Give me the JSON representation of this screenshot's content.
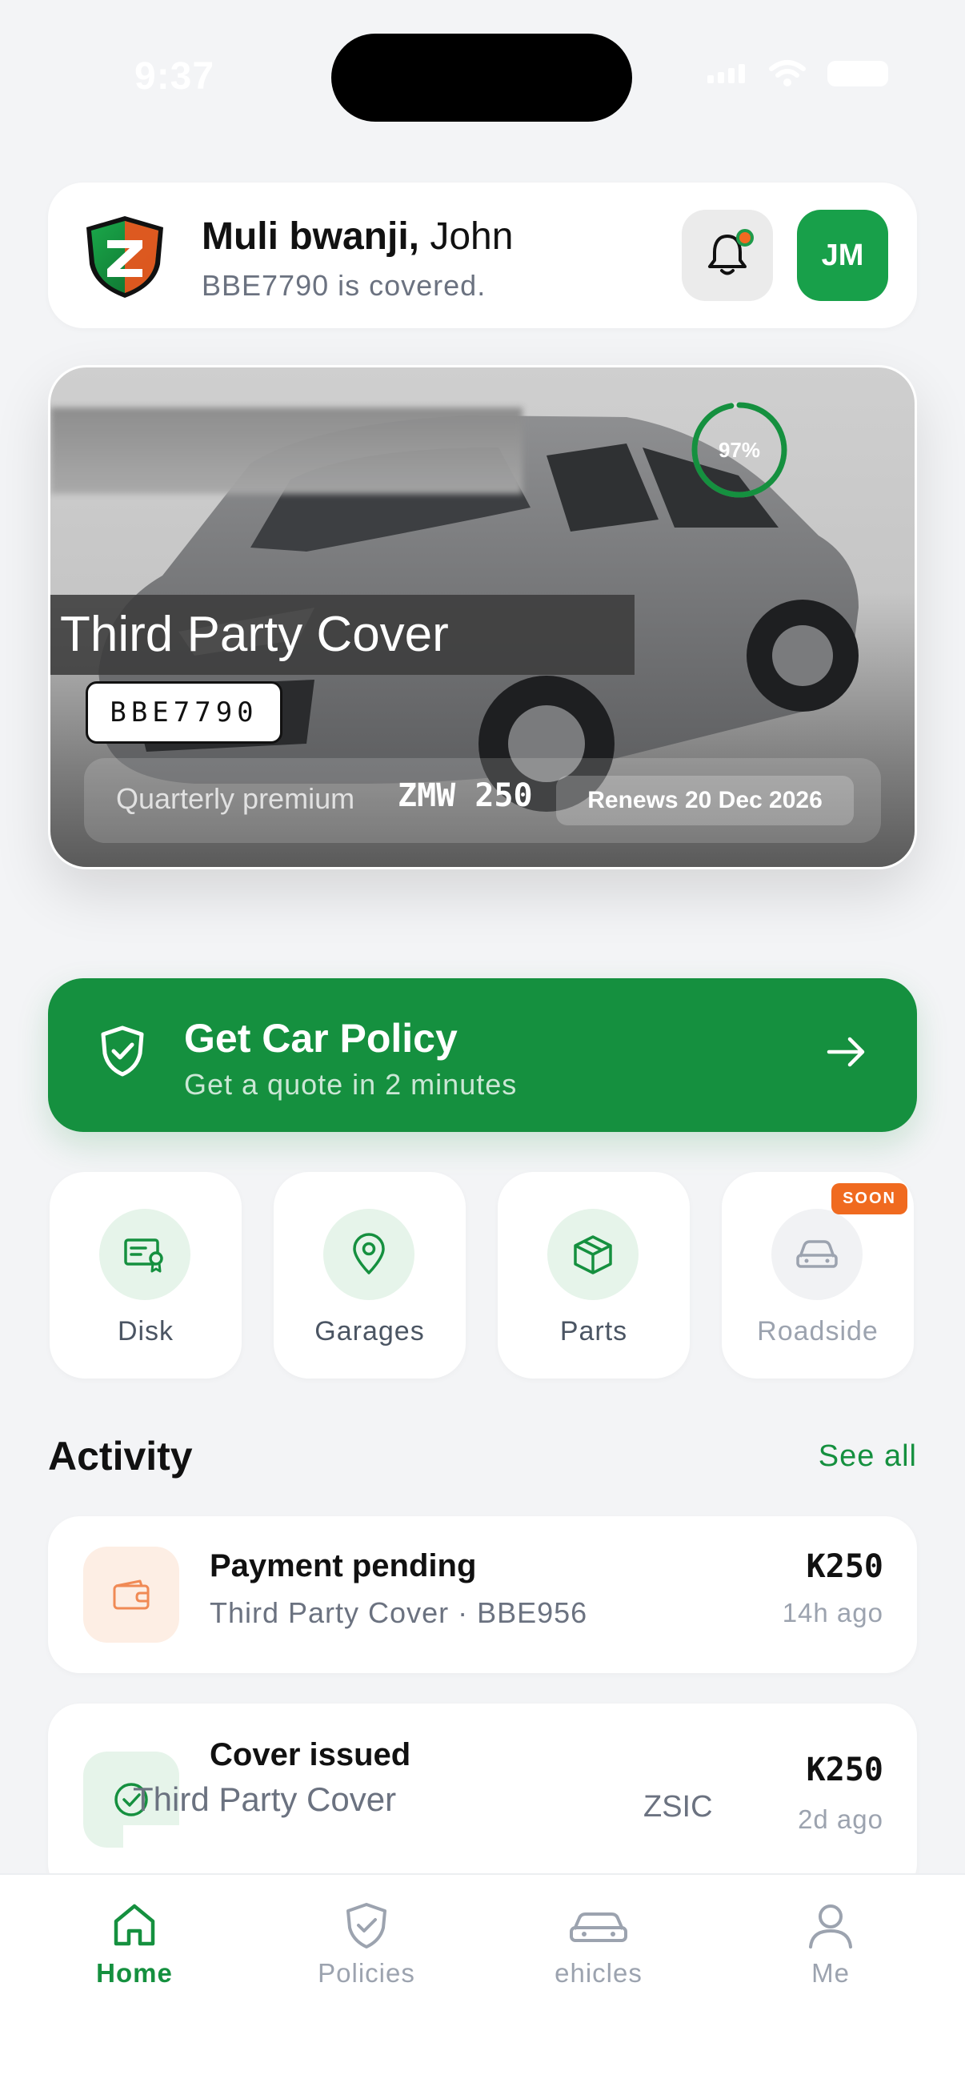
{
  "status": {
    "time": "9:37"
  },
  "header": {
    "greeting": "Muli bwanji,",
    "name": "John",
    "covered_text": "BBE7790 is covered.",
    "avatar_initials": "JM",
    "icons": [
      "shield-z-logo-icon",
      "bell-icon"
    ]
  },
  "hero": {
    "progress_text": "97%",
    "progress": 0.97,
    "cover_type": "Third Party Cover",
    "plate": "BBE7790",
    "premium_label": "Quarterly premium",
    "premium_amount": "ZMW 250",
    "renews": "Renews 20 Dec 2026"
  },
  "cta": {
    "title": "Get Car Policy",
    "subtitle": "Get a quote in 2 minutes",
    "color": "#15903f"
  },
  "quick_actions": [
    {
      "label": "Disk",
      "icon": "certificate-icon"
    },
    {
      "label": "Garages",
      "icon": "map-pin-icon"
    },
    {
      "label": "Parts",
      "icon": "box-icon"
    },
    {
      "label": "Roadside",
      "icon": "car-icon",
      "badge": "SOON"
    }
  ],
  "activity": {
    "title": "Activity",
    "see_all": "See all",
    "items": [
      {
        "title": "Payment pending",
        "subtitle": "Third Party Cover · BBE956",
        "amount": "K250",
        "time": "14h ago",
        "icon": "wallet-icon"
      },
      {
        "title": "Cover issued",
        "subtitle_partial": "ZSIC",
        "amount": "K250",
        "time": "2d ago",
        "icon": "check-circle-icon"
      }
    ],
    "overlay_text": "Third Party Cover"
  },
  "tabs": [
    {
      "label": "Home",
      "icon": "home-icon",
      "active": true
    },
    {
      "label": "Policies",
      "icon": "shield-check-icon",
      "active": false
    },
    {
      "label": "Vehicles",
      "display": "ehicles",
      "icon": "car-icon",
      "active": false
    },
    {
      "label": "Me",
      "icon": "user-icon",
      "active": false
    }
  ],
  "colors": {
    "brand_green": "#15903f",
    "accent_orange": "#f06a1f",
    "background": "#f3f4f6"
  }
}
